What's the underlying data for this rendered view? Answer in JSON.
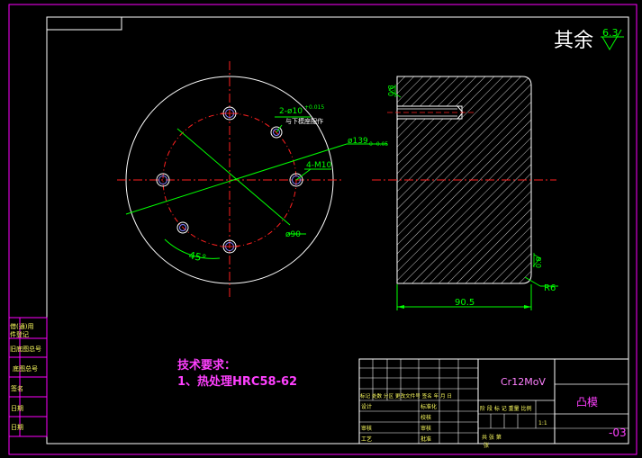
{
  "drawing": {
    "roughness_note": "其余",
    "roughness_value": "6.3",
    "material": "Cr12MoV",
    "part_name": "凸模",
    "drawing_number": "-03",
    "front_view": {
      "holes_note": "2-ø10",
      "holes_note_tol": "+0.015",
      "holes_note_sub": "与下模座配作",
      "outer_dia": "ø139",
      "outer_dia_tol": "0 -0.05",
      "thread_note": "4-M10",
      "bolt_circle": "ø90",
      "angle": "45°"
    },
    "side_view": {
      "roughness_left": "0.8",
      "length": "90.5",
      "fillet": "R6",
      "roughness_right": "0.8"
    },
    "tech_requirements": {
      "title": "技术要求：",
      "item1": "1、热处理HRC58-62"
    },
    "side_stamp": [
      "借(通)用",
      "件登记",
      "旧底图总号",
      "底图总号",
      "签名",
      "日期",
      "日期"
    ],
    "title_block": {
      "header_row": "标记 处数 分区 更改文件号 签名 年 月 日",
      "design": "设计",
      "standard": "标准化",
      "review": "审核",
      "process": "工艺",
      "approve": "批准",
      "check": "校核",
      "stage_labels": "阶 段 标 记  重量  比例",
      "scale": "1:1",
      "sheet": "共   张   第",
      "sheet2": "张"
    },
    "colors": {
      "background": "#000000",
      "outline": "#ffffff",
      "border": "#ff00ff",
      "center": "#ff0000",
      "dimension": "#00ff00",
      "magenta_text": "#ff40ff"
    }
  }
}
